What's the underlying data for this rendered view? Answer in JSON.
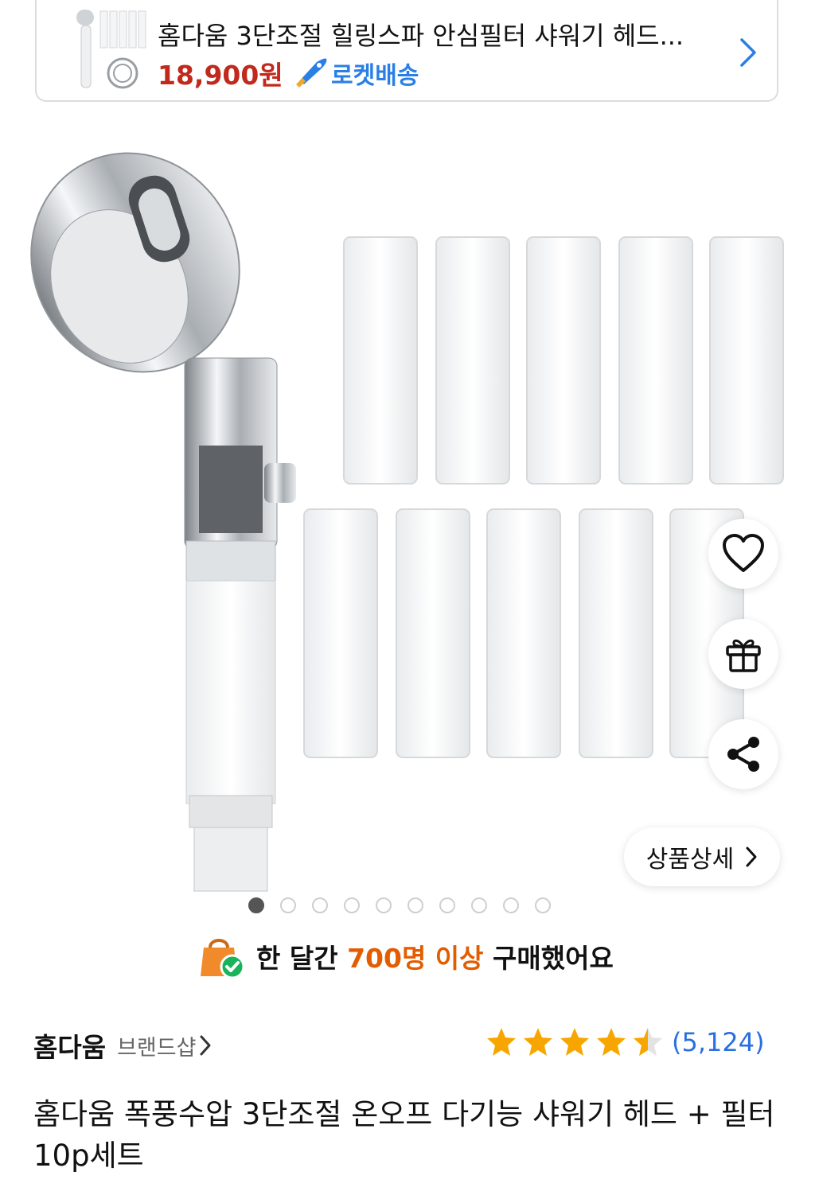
{
  "mini_card": {
    "title": "홈다움 3단조절 힐링스파 안심필터 샤워기 헤드...",
    "price": "18,900원",
    "delivery_label": "로켓배송"
  },
  "detail_button": {
    "label": "상품상세"
  },
  "carousel": {
    "total": 10,
    "active_index": 0
  },
  "purchase_banner": {
    "prefix": "한 달간",
    "highlight": "700명 이상",
    "suffix": "구매했어요"
  },
  "brand": {
    "name": "홈다움",
    "shop_link": "브랜드샵"
  },
  "rating": {
    "stars": 4.5,
    "max": 5,
    "count": "(5,124)"
  },
  "product_title": "홈다움 폭풍수압 3단조절 온오프 다기능 샤워기 헤드 + 필터 10p세트",
  "colors": {
    "price": "#c0291c",
    "rocket": "#2a7fe6",
    "highlight": "#e35c00",
    "star": "#f7a600",
    "review_count": "#2a6fe0"
  }
}
